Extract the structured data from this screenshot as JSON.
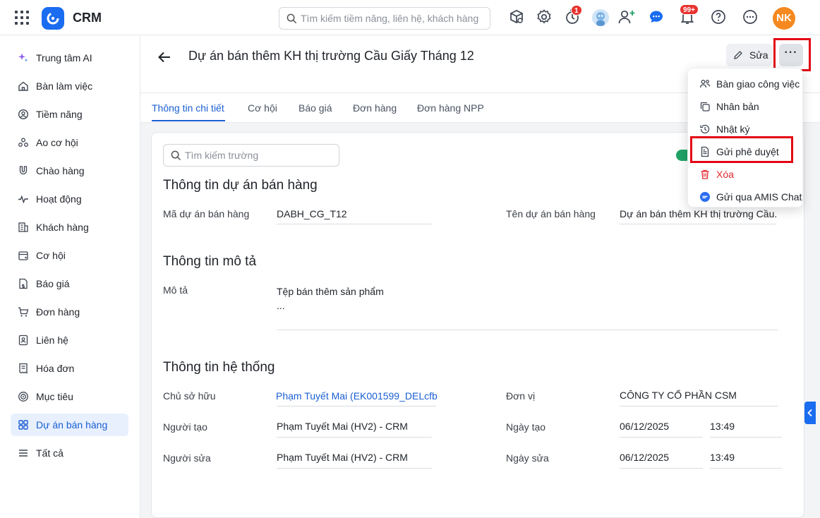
{
  "app": {
    "brand": "CRM"
  },
  "search": {
    "placeholder": "Tìm kiếm tiềm năng, liên hệ, khách hàng"
  },
  "topbar": {
    "timer_badge": "1",
    "notif_badge": "99+",
    "user_initials": "NK"
  },
  "sidebar": {
    "items": [
      {
        "label": "Trung tâm AI"
      },
      {
        "label": "Bàn làm việc"
      },
      {
        "label": "Tiềm năng"
      },
      {
        "label": "Ao cơ hội"
      },
      {
        "label": "Chào hàng"
      },
      {
        "label": "Hoạt động"
      },
      {
        "label": "Khách hàng"
      },
      {
        "label": "Cơ hội"
      },
      {
        "label": "Báo giá"
      },
      {
        "label": "Đơn hàng"
      },
      {
        "label": "Liên hệ"
      },
      {
        "label": "Hóa đơn"
      },
      {
        "label": "Mục tiêu"
      },
      {
        "label": "Dự án bán hàng"
      },
      {
        "label": "Tất cả"
      }
    ]
  },
  "header": {
    "title": "Dự án bán thêm KH thị trường Cầu Giấy Tháng 12",
    "edit_label": "Sửa",
    "more_label": "···"
  },
  "tabs": [
    {
      "label": "Thông tin chi tiết"
    },
    {
      "label": "Cơ hội"
    },
    {
      "label": "Báo giá"
    },
    {
      "label": "Đơn hàng"
    },
    {
      "label": "Đơn hàng NPP"
    }
  ],
  "field_search": {
    "placeholder": "Tìm kiếm trường"
  },
  "sections": {
    "sales_project": {
      "title": "Thông tin dự án bán hàng",
      "code_label": "Mã dự án bán hàng",
      "code_value": "DABH_CG_T12",
      "name_label": "Tên dự án bán hàng",
      "name_value": "Dự án bán thêm KH thị trường Cầu..."
    },
    "description": {
      "title": "Thông tin mô tả",
      "desc_label": "Mô tả",
      "desc_line1": "Tệp bán thêm sản phẩm",
      "desc_line2": "..."
    },
    "system": {
      "title": "Thông tin hệ thống",
      "owner_label": "Chủ sở hữu",
      "owner_value": "Phạm Tuyết Mai (EK001599_DELcfb",
      "unit_label": "Đơn vị",
      "unit_value": "CÔNG TY CỔ PHẦN CSM",
      "creator_label": "Người tạo",
      "creator_value": "Phạm Tuyết Mai (HV2) - CRM",
      "created_label": "Ngày tạo",
      "created_date": "06/12/2025",
      "created_time": "13:49",
      "modifier_label": "Người sửa",
      "modifier_value": "Phạm Tuyết Mai (HV2) - CRM",
      "modified_label": "Ngày sửa",
      "modified_date": "06/12/2025",
      "modified_time": "13:49"
    }
  },
  "menu": {
    "items": [
      {
        "label": "Bàn giao công việc"
      },
      {
        "label": "Nhân bản"
      },
      {
        "label": "Nhật ký"
      },
      {
        "label": "Gửi phê duyệt"
      },
      {
        "label": "Xóa"
      },
      {
        "label": "Gửi qua AMIS Chat"
      }
    ]
  },
  "colors": {
    "accent": "#1a5fd1",
    "highlight": "#e30613",
    "danger": "#e0282e",
    "avatar": "#f5891f"
  }
}
